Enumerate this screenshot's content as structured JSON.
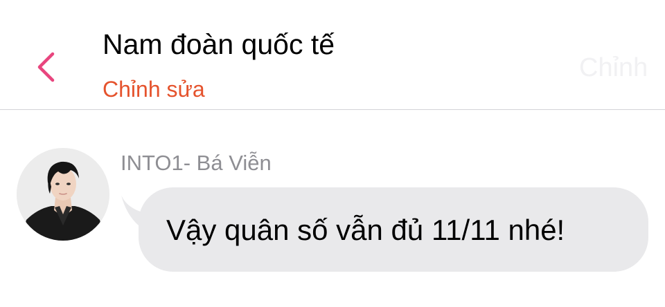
{
  "header": {
    "title": "Nam đoàn quốc tế",
    "edit_label": "Chỉnh sửa",
    "faded_label": "Chỉnh",
    "back_icon": "chevron-left-icon",
    "accent_color": "#e5532d",
    "back_color": "#e8457e"
  },
  "message": {
    "sender": "INTO1- Bá Viễn",
    "text": "Vậy quân số vẫn đủ 11/11 nhé!",
    "bubble_color": "#e9e9eb"
  }
}
